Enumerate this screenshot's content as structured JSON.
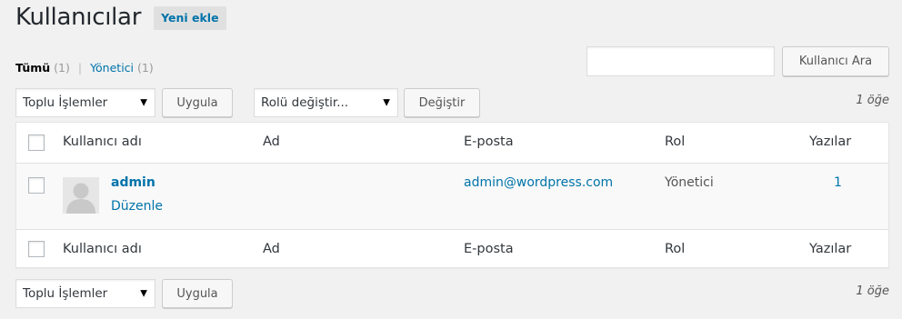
{
  "header": {
    "title": "Kullanıcılar",
    "add_new": "Yeni ekle"
  },
  "filters": {
    "all_label": "Tümü",
    "all_count": "(1)",
    "separator": "|",
    "admin_label": "Yönetici",
    "admin_count": "(1)"
  },
  "search": {
    "value": "",
    "button": "Kullanıcı Ara"
  },
  "tablenav_top": {
    "bulk_actions": "Toplu İşlemler",
    "apply": "Uygula",
    "change_role": "Rolü değiştir...",
    "change": "Değiştir",
    "item_count": "1 öğe"
  },
  "table": {
    "columns": {
      "username": "Kullanıcı adı",
      "name": "Ad",
      "email": "E-posta",
      "role": "Rol",
      "posts": "Yazılar"
    },
    "rows": [
      {
        "username": "admin",
        "edit": "Düzenle",
        "name": "",
        "email": "admin@wordpress.com",
        "role": "Yönetici",
        "posts": "1"
      }
    ]
  },
  "tablenav_bottom": {
    "bulk_actions": "Toplu İşlemler",
    "apply": "Uygula",
    "item_count": "1 öğe"
  },
  "icons": {
    "select_arrow": "triangle-down-icon",
    "avatar": "user-avatar-icon"
  },
  "colors": {
    "link": "#0073aa",
    "background": "#f1f1f1"
  }
}
